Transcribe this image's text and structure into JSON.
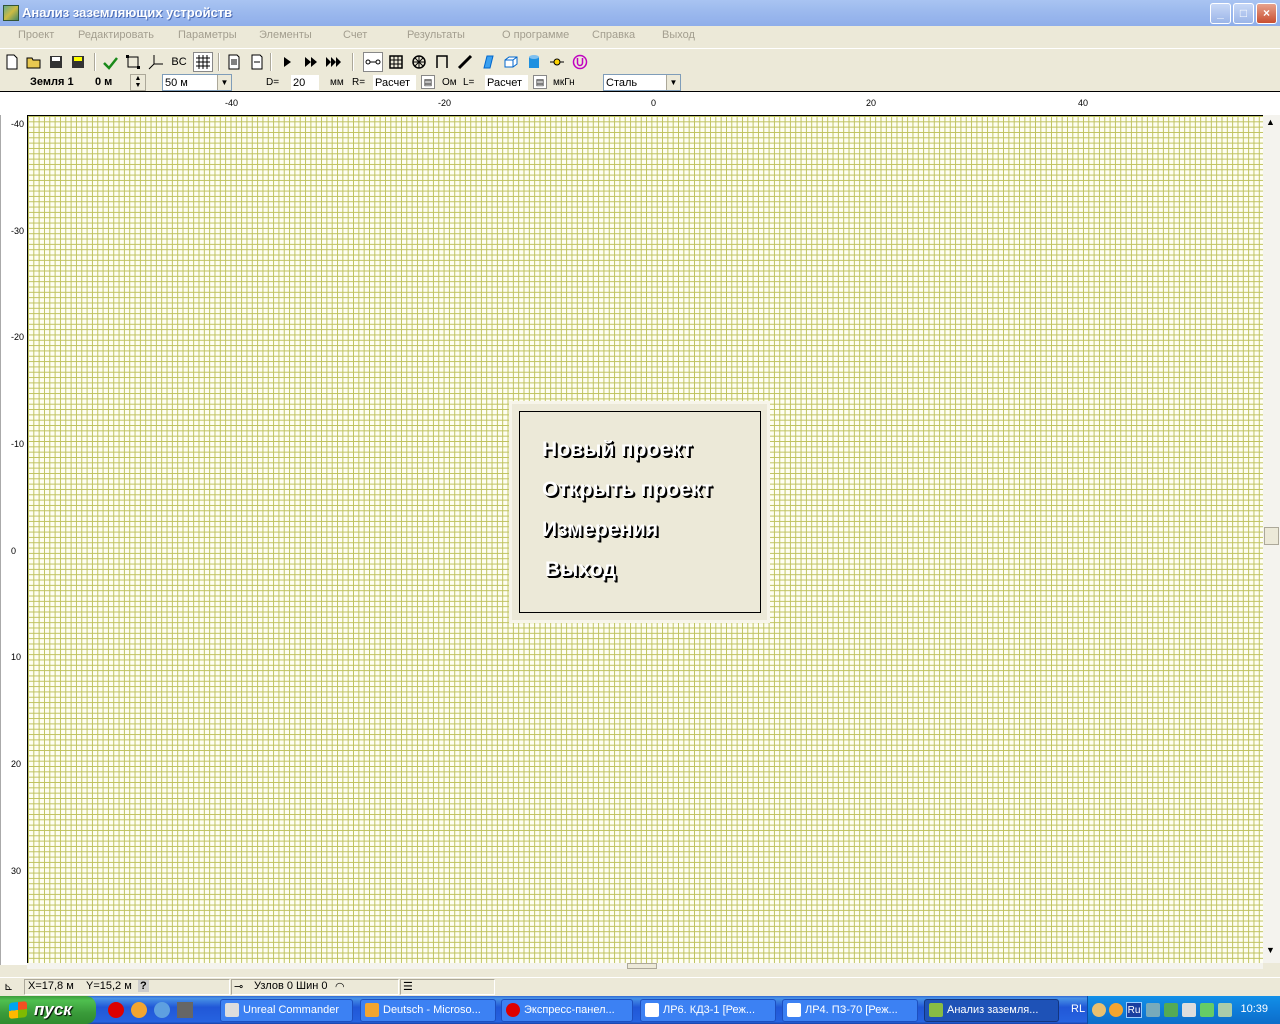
{
  "window": {
    "title": "Анализ заземляющих устройств",
    "controls": {
      "minimize": "_",
      "maximize": "□",
      "close": "×"
    }
  },
  "menu": [
    "Проект",
    "Редактировать",
    "Параметры",
    "Элементы",
    "Счет",
    "Результаты",
    "О программе",
    "Справка",
    "Выход"
  ],
  "toolbar": {
    "bc_label": "BC"
  },
  "paramsbar": {
    "layer": "Земля 1",
    "depth": "0 м",
    "size_value": "50 м",
    "d_label": "D=",
    "d_value": "20",
    "mm_label": "мм",
    "r_label": "R=",
    "r_value": "Расчет",
    "ohm_label": "Ом",
    "l_label": "L=",
    "l_value": "Расчет",
    "uh_label": "мкГн",
    "material_value": "Сталь"
  },
  "ruler": {
    "x_ticks": [
      "-40",
      "-20",
      "0",
      "20",
      "40"
    ],
    "y_ticks": [
      "-40",
      "-30",
      "-20",
      "-10",
      "0",
      "10",
      "20",
      "30"
    ]
  },
  "start_dialog": {
    "items": [
      "Новый проект",
      "Открыть проект",
      "Измерения",
      "Выход"
    ]
  },
  "status": {
    "x": "X=17,8 м",
    "y": "Y=15,2 м",
    "help": "?",
    "nodes": "Узлов 0 Шин 0"
  },
  "taskbar": {
    "start": "пуск",
    "tasks": [
      "Unreal Commander",
      "Deutsch - Microso...",
      "Экспресс-панел...",
      "ЛР6. КД3-1 [Реж...",
      "ЛР4. ПЗ-70 [Реж...",
      "Анализ заземля..."
    ],
    "tray_rl": "RL",
    "tray_lang": "Ru",
    "clock": "10:39"
  }
}
